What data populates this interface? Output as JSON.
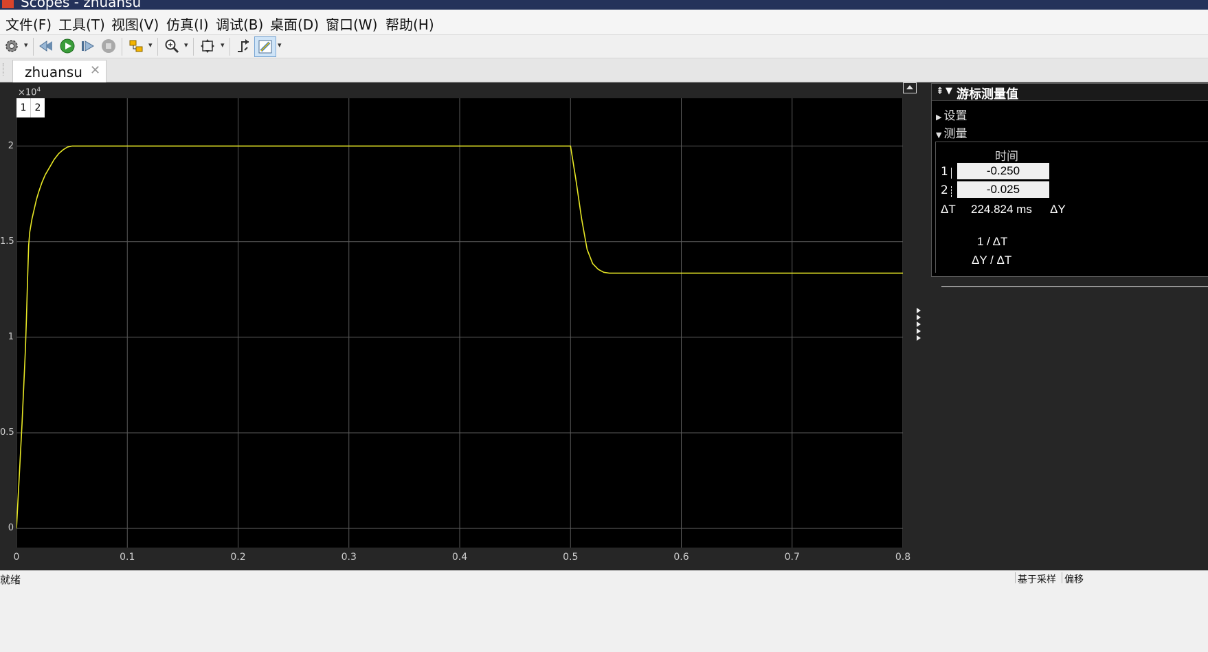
{
  "window": {
    "title": "Scopes - zhuansu"
  },
  "menu": [
    {
      "label": "文件(F)"
    },
    {
      "label": "工具(T)"
    },
    {
      "label": "视图(V)"
    },
    {
      "label": "仿真(I)"
    },
    {
      "label": "调试(B)"
    },
    {
      "label": "桌面(D)"
    },
    {
      "label": "窗口(W)"
    },
    {
      "label": "帮助(H)"
    }
  ],
  "toolbar": {
    "icons": [
      "settings-gear-icon",
      "step-back-icon",
      "run-icon",
      "step-forward-icon",
      "stop-icon",
      "highlight-block-icon",
      "zoom-in-icon",
      "autoscale-icon",
      "triggers-icon",
      "cursor-measurements-icon"
    ],
    "active": "cursor-measurements-icon"
  },
  "tab": {
    "label": "zhuansu",
    "close_glyph": "✕"
  },
  "scope": {
    "exponent_base": "×10",
    "exponent_power": "4",
    "legend": [
      "1",
      "2"
    ]
  },
  "chart_data": {
    "type": "line",
    "title": "",
    "xlabel": "",
    "ylabel": "",
    "xlim": [
      0,
      0.8
    ],
    "ylim": [
      -0.1,
      2.25
    ],
    "y_multiplier": 10000,
    "grid": true,
    "x_ticks": [
      "0",
      "0.1",
      "0.2",
      "0.3",
      "0.4",
      "0.5",
      "0.6",
      "0.7",
      "0.8"
    ],
    "y_ticks": [
      "0",
      "0.5",
      "1",
      "1.5",
      "2"
    ],
    "series": [
      {
        "color": "#e8e825",
        "x": [
          0,
          0.005,
          0.008,
          0.009,
          0.01,
          0.011,
          0.012,
          0.014,
          0.016,
          0.018,
          0.02,
          0.023,
          0.026,
          0.03,
          0.034,
          0.038,
          0.042,
          0.046,
          0.05,
          0.1,
          0.2,
          0.3,
          0.4,
          0.5,
          0.505,
          0.51,
          0.515,
          0.52,
          0.525,
          0.53,
          0.535,
          0.54,
          0.6,
          0.7,
          0.8
        ],
        "y": [
          0,
          0.55,
          0.93,
          1.1,
          1.3,
          1.48,
          1.55,
          1.62,
          1.67,
          1.72,
          1.76,
          1.81,
          1.85,
          1.89,
          1.93,
          1.96,
          1.98,
          1.995,
          2.0,
          2.0,
          2.0,
          2.0,
          2.0,
          2.0,
          1.82,
          1.62,
          1.46,
          1.385,
          1.355,
          1.34,
          1.335,
          1.335,
          1.335,
          1.335,
          1.335
        ]
      }
    ]
  },
  "cursor_panel": {
    "title": "游标测量值",
    "settings_label": "设置",
    "measurements_label": "测量",
    "time_header": "时间",
    "row1_index": "1",
    "row1_value": "-0.250",
    "row2_index": "2",
    "row2_value": "-0.025",
    "delta_t_label": "ΔT",
    "delta_t_value": "224.824 ms",
    "delta_y_label": "ΔY",
    "inv_dt_label": "1 / ΔT",
    "dy_dt_label": "ΔY / ΔT"
  },
  "status": {
    "text": "就绪",
    "sample_based": "基于采样",
    "offset": "偏移"
  },
  "colors": {
    "plot_bg": "#000000",
    "frame_bg": "#262626",
    "signal": "#e8e825",
    "grid": "#5a5a5a"
  }
}
